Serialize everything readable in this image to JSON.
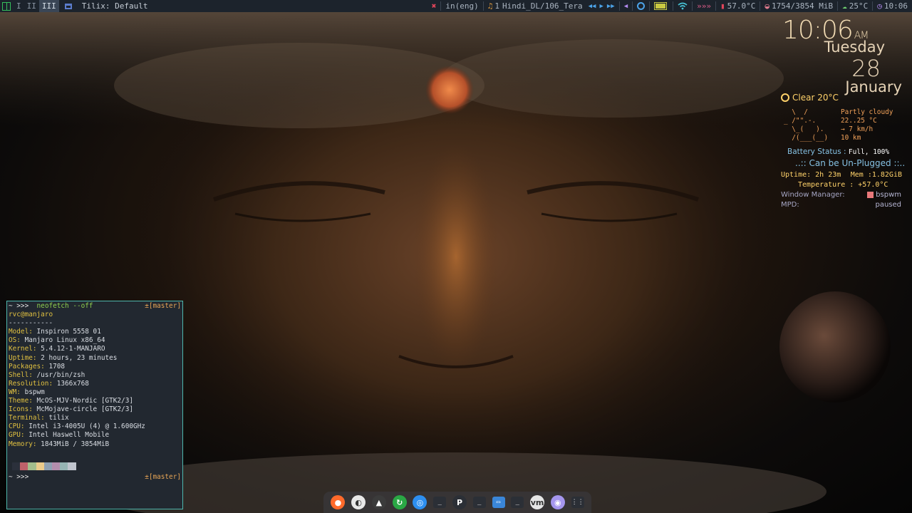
{
  "topbar": {
    "workspaces": [
      "I",
      "II",
      "III"
    ],
    "active_workspace": "III",
    "window_title": "Tilix: Default",
    "close_glyph": "✖",
    "keyboard_layout": "in(eng)",
    "music_glyph": "♫",
    "track_number": "1",
    "track": "Hindi_DL/106_Tera",
    "media": {
      "prev": "◀◀",
      "play": "▶",
      "next": "▶▶"
    },
    "volume_glyph": "◀",
    "wifi_glyph": "wifi",
    "arrows": "»»»",
    "cpu_temp": "57.0°C",
    "memory": "1754/3854 MiB",
    "weather_temp": "25°C",
    "time": "10:06",
    "colors": {
      "bar": "#1c232c",
      "accent_green": "#35bf5c",
      "red": "#e0455a"
    }
  },
  "conky": {
    "time": "10:06",
    "ampm": "AM",
    "day": "Tuesday",
    "date": "28",
    "month": "January",
    "weather": "Clear 20°C",
    "wttr_art": "  \\  /\n_ /\"\".-.\n  \\_(   ).\n  /(___(__)",
    "wttr_info": "Partly cloudy\n22..25 °C\n→ 7 km/h\n10 km",
    "battery_label": "Battery Status :",
    "battery_value": "Full, 100%",
    "unplug": "..:: Can be Un-Plugged ::..",
    "uptime": "Uptime: 2h 23m",
    "mem": "Mem :1.82GiB",
    "temperature": "Temperature : +57.0°C",
    "wm_label": "Window Manager:",
    "wm_value": "bspwm",
    "mpd_label": "MPD:",
    "mpd_value": "paused"
  },
  "terminal": {
    "prompt": "~ >>>",
    "command": "neofetch --off",
    "branch": "±[master]",
    "user_host": "rvc@manjaro",
    "separator": "-----------",
    "info": [
      {
        "key": "Model:",
        "value": "Inspiron 5558 01"
      },
      {
        "key": "OS:",
        "value": "Manjaro Linux x86_64"
      },
      {
        "key": "Kernel:",
        "value": "5.4.12-1-MANJARO"
      },
      {
        "key": "Uptime:",
        "value": "2 hours, 23 minutes"
      },
      {
        "key": "Packages:",
        "value": "1708"
      },
      {
        "key": "Shell:",
        "value": "/usr/bin/zsh"
      },
      {
        "key": "Resolution:",
        "value": "1366x768"
      },
      {
        "key": "WM:",
        "value": "bspwm"
      },
      {
        "key": "Theme:",
        "value": "McOS-MJV-Nordic [GTK2/3]"
      },
      {
        "key": "Icons:",
        "value": "McMojave-circle [GTK2/3]"
      },
      {
        "key": "Terminal:",
        "value": "tilix"
      },
      {
        "key": "CPU:",
        "value": "Intel i3-4005U (4) @ 1.600GHz"
      },
      {
        "key": "GPU:",
        "value": "Intel Haswell Mobile"
      },
      {
        "key": "Memory:",
        "value": "1843MiB / 3854MiB"
      }
    ],
    "palette": [
      "#2b303b",
      "#bf616a",
      "#a3be8c",
      "#ebcb8b",
      "#8fa1b3",
      "#b48ead",
      "#96b5b4",
      "#c0c5ce"
    ],
    "border_color": "#4fb7ad"
  },
  "dock": {
    "items": [
      {
        "name": "firefox-icon",
        "glyph": "●",
        "bg": "#ff6a2b"
      },
      {
        "name": "files-icon",
        "glyph": "◐",
        "bg": "#e8e8e8"
      },
      {
        "name": "manjaro-settings-icon",
        "glyph": "▲",
        "bg": "#3b3b3b"
      },
      {
        "name": "refresh-icon",
        "glyph": "↻",
        "bg": "#2aa845"
      },
      {
        "name": "globe-icon",
        "glyph": "◎",
        "bg": "#2d8ff0"
      },
      {
        "name": "terminal-icon",
        "glyph": "_",
        "bg": "#2b2f36"
      },
      {
        "name": "p-app-icon",
        "glyph": "P",
        "bg": "#2b2f36"
      },
      {
        "name": "terminal-2-icon",
        "glyph": "_",
        "bg": "#2b2f36"
      },
      {
        "name": "window-icon",
        "glyph": "▭",
        "bg": "#3a86d8"
      },
      {
        "name": "terminal-3-icon",
        "glyph": "_",
        "bg": "#2b2f36"
      },
      {
        "name": "vm-icon",
        "glyph": "vm",
        "bg": "#e6e6e6"
      },
      {
        "name": "discord-icon",
        "glyph": "◉",
        "bg": "#a596ee"
      },
      {
        "name": "tilix-icon",
        "glyph": "⋮⋮",
        "bg": "#2b2f36"
      }
    ]
  }
}
